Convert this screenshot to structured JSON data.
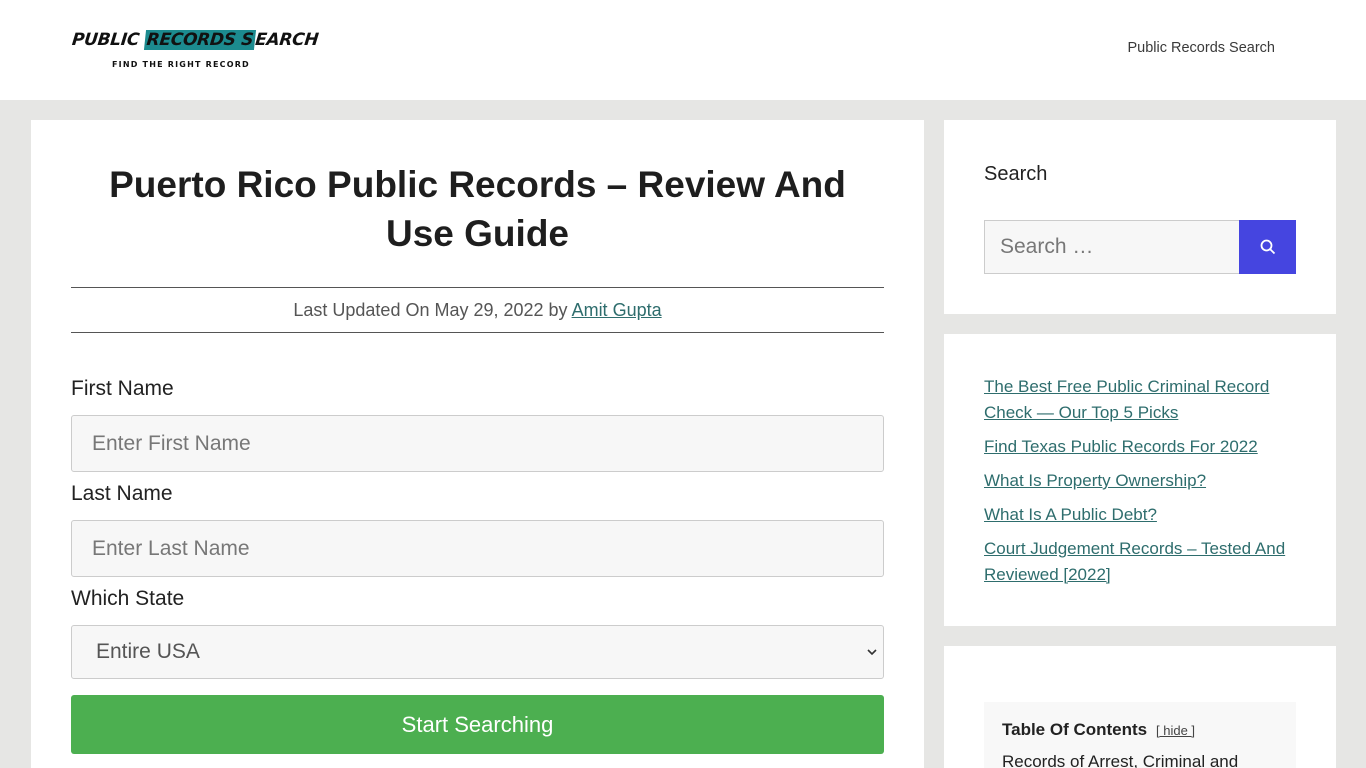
{
  "header": {
    "logo_main_pre": "PUBLIC ",
    "logo_main_hl": "RECORDS S",
    "logo_main_post": "EARCH",
    "logo_sub": "FIND THE RIGHT RECORD",
    "nav_link": "Public Records Search"
  },
  "article": {
    "title": "Puerto Rico Public Records – Review And Use Guide",
    "meta_prefix": "Last Updated On May 29, 2022 by ",
    "author": "Amit Gupta"
  },
  "form": {
    "first_name_label": "First Name",
    "first_name_placeholder": "Enter First Name",
    "last_name_label": "Last Name",
    "last_name_placeholder": "Enter Last Name",
    "state_label": "Which State",
    "state_selected": "Entire USA",
    "submit_label": "Start Searching"
  },
  "sidebar": {
    "search_title": "Search",
    "search_placeholder": "Search …",
    "links": [
      "The Best Free Public Criminal Record Check — Our Top 5 Picks",
      "Find Texas Public Records For 2022",
      "What Is Property Ownership?",
      "What Is A Public Debt?",
      "Court Judgement Records – Tested And Reviewed [2022]"
    ],
    "toc_title": "Table Of Contents",
    "toc_hide": "[ hide ]",
    "toc_first_item": "Records of Arrest, Criminal and"
  },
  "colors": {
    "accent_green": "#4caf50",
    "search_button": "#4545e0",
    "link": "#2e6d6d",
    "logo_highlight": "#1c8b8f"
  }
}
